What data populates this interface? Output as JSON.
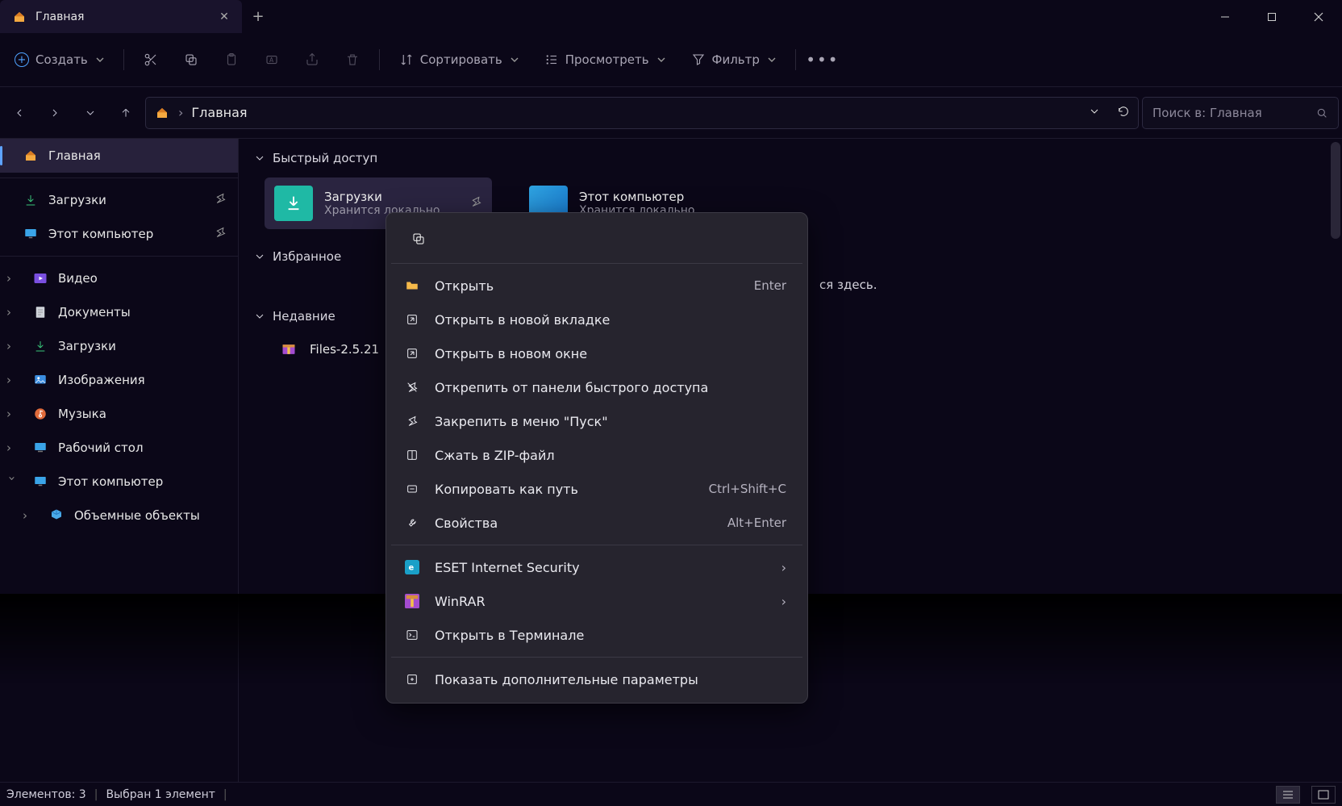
{
  "title_tab": "Главная",
  "toolbar": {
    "create": "Создать",
    "sort": "Сортировать",
    "view": "Просмотреть",
    "filter": "Фильтр"
  },
  "breadcrumb": "Главная",
  "search_placeholder": "Поиск в: Главная",
  "sidebar": {
    "home": "Главная",
    "downloads": "Загрузки",
    "this_pc": "Этот компьютер",
    "lib": {
      "video": "Видео",
      "documents": "Документы",
      "downloads": "Загрузки",
      "pictures": "Изображения",
      "music": "Музыка",
      "desktop": "Рабочий стол",
      "this_pc": "Этот компьютер",
      "objects3d": "Объемные объекты"
    }
  },
  "content": {
    "section_quick": "Быстрый доступ",
    "section_fav": "Избранное",
    "section_recent": "Недавние",
    "card_downloads": {
      "title": "Загрузки",
      "subtitle": "Хранится локально"
    },
    "card_thispc": {
      "title": "Этот компьютер",
      "subtitle": "Хранится локально"
    },
    "fav_msg_tail": "ся здесь.",
    "recent_file": "Files-2.5.21"
  },
  "context_menu": {
    "open": "Открыть",
    "open_kbd": "Enter",
    "open_tab": "Открыть в новой вкладке",
    "open_win": "Открыть в новом окне",
    "unpin": "Открепить от панели быстрого доступа",
    "pin_start": "Закрепить в меню \"Пуск\"",
    "zip": "Сжать в ZIP-файл",
    "copy_path": "Копировать как путь",
    "copy_path_kbd": "Ctrl+Shift+C",
    "properties": "Свойства",
    "properties_kbd": "Alt+Enter",
    "eset": "ESET Internet Security",
    "winrar": "WinRAR",
    "terminal": "Открыть в Терминале",
    "more_params": "Показать дополнительные параметры"
  },
  "status": {
    "items": "Элементов: 3",
    "selected": "Выбран 1 элемент"
  }
}
